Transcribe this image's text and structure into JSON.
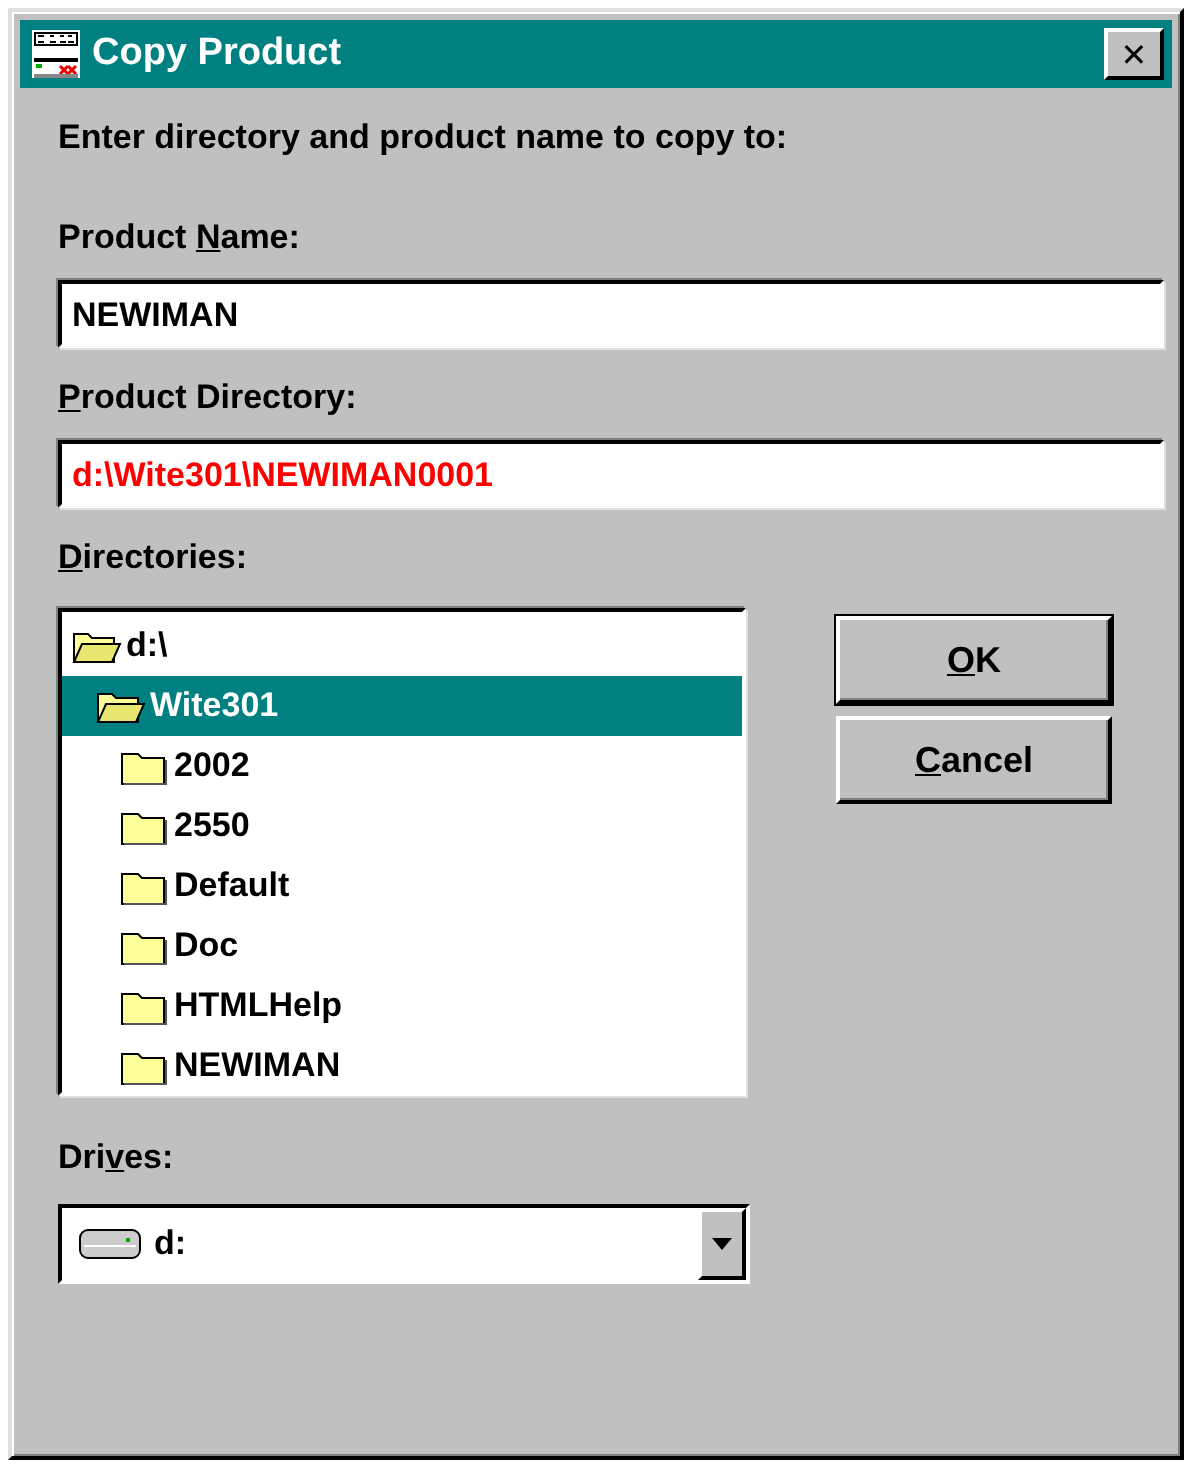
{
  "window": {
    "title": "Copy Product",
    "close": "✕"
  },
  "instruction": "Enter directory and product name to copy to:",
  "product_name": {
    "label": {
      "before": "Product ",
      "key": "N",
      "after": "ame:"
    },
    "value": "NEWIMAN"
  },
  "product_directory": {
    "label": {
      "key": "P",
      "after": "roduct Directory:"
    },
    "value": "d:\\Wite301\\NEWIMAN0001"
  },
  "directories": {
    "label": {
      "key": "D",
      "after": "irectories:"
    },
    "tree": [
      {
        "name": "d:\\",
        "expanded": true,
        "selected": false,
        "children": [
          {
            "name": "Wite301",
            "expanded": true,
            "selected": true,
            "children": [
              {
                "name": "2002",
                "expanded": false,
                "selected": false
              },
              {
                "name": "2550",
                "expanded": false,
                "selected": false
              },
              {
                "name": "Default",
                "expanded": false,
                "selected": false
              },
              {
                "name": "Doc",
                "expanded": false,
                "selected": false
              },
              {
                "name": "HTMLHelp",
                "expanded": false,
                "selected": false
              },
              {
                "name": "NEWIMAN",
                "expanded": false,
                "selected": false
              }
            ]
          }
        ]
      }
    ]
  },
  "buttons": [
    {
      "key": "O",
      "after": "K"
    },
    {
      "key": "C",
      "after": "ancel"
    }
  ],
  "drives": {
    "label": {
      "before": "Dri",
      "key": "v",
      "after": "es:"
    },
    "value": "d:"
  }
}
